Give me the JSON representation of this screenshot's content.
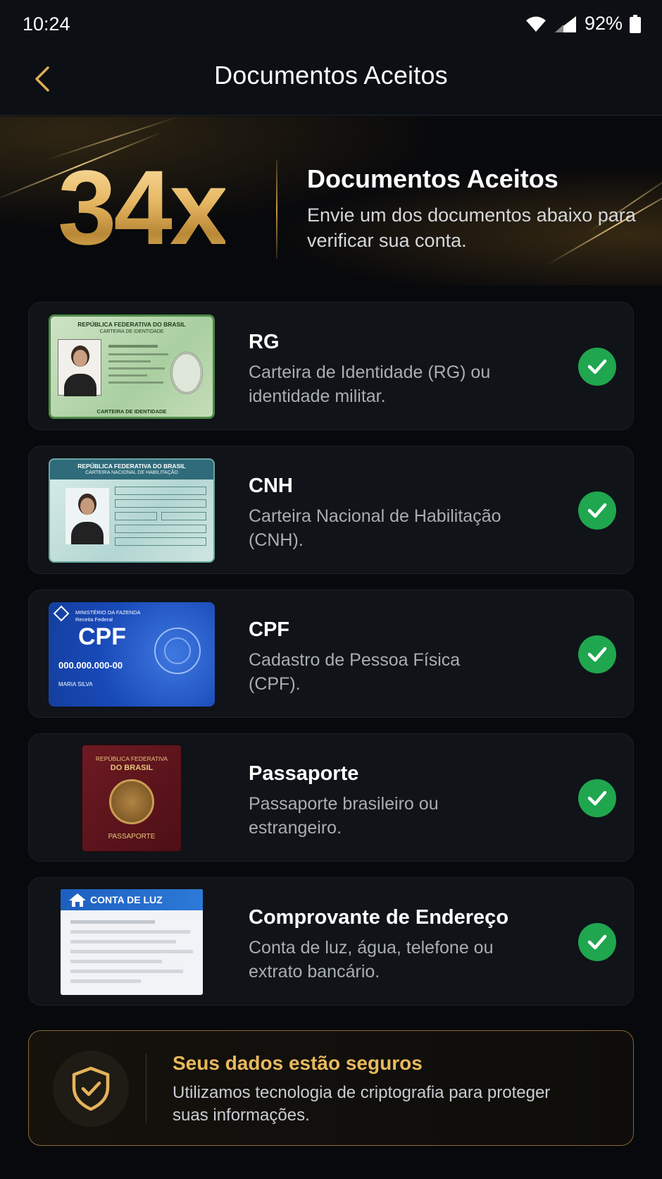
{
  "status_bar": {
    "time": "10:24",
    "battery": "92%"
  },
  "header": {
    "title": "Documentos Aceitos"
  },
  "hero": {
    "count": "34x",
    "title": "Documentos Aceitos",
    "subtitle": "Envie um dos documentos abaixo para verificar sua conta."
  },
  "documents": [
    {
      "name": "RG",
      "description": "Carteira de Identidade (RG) ou identidade militar.",
      "thumb_header": "REPÚBLICA FEDERATIVA DO BRASIL",
      "thumb_sub": "CARTEIRA DE IDENTIDADE",
      "thumb_footer": "CARTEIRA DE IDENTIDADE",
      "accepted": true
    },
    {
      "name": "CNH",
      "description": "Carteira Nacional de Habilitação (CNH).",
      "thumb_header": "REPÚBLICA FEDERATIVA DO BRASIL",
      "thumb_sub": "CARTEIRA NACIONAL DE HABILITAÇÃO",
      "accepted": true
    },
    {
      "name": "CPF",
      "description": "Cadastro de Pessoa Física (CPF).",
      "thumb_ministry": "MINISTÉRIO DA FAZENDA",
      "thumb_agency": "Receita Federal",
      "thumb_title": "CPF",
      "thumb_number": "000.000.000-00",
      "thumb_holder": "MARIA SILVA",
      "accepted": true
    },
    {
      "name": "Passaporte",
      "description": "Passaporte brasileiro ou estrangeiro.",
      "thumb_line1": "REPÚBLICA FEDERATIVA",
      "thumb_line2": "DO BRASIL",
      "thumb_label": "PASSAPORTE",
      "accepted": true
    },
    {
      "name": "Comprovante de Endereço",
      "description": "Conta de luz, água, telefone ou extrato bancário.",
      "thumb_title": "CONTA DE LUZ",
      "accepted": true
    }
  ],
  "security": {
    "title": "Seus dados estão seguros",
    "description": "Utilizamos tecnologia de criptografia para proteger suas informações."
  },
  "colors": {
    "accent_gold": "#eab95c",
    "check_green": "#1fa64f",
    "background": "#07090d",
    "card": "#101318"
  },
  "icons": [
    "wifi-icon",
    "signal-icon",
    "battery-icon",
    "back-arrow-icon",
    "check-icon",
    "shield-check-icon",
    "house-icon"
  ]
}
